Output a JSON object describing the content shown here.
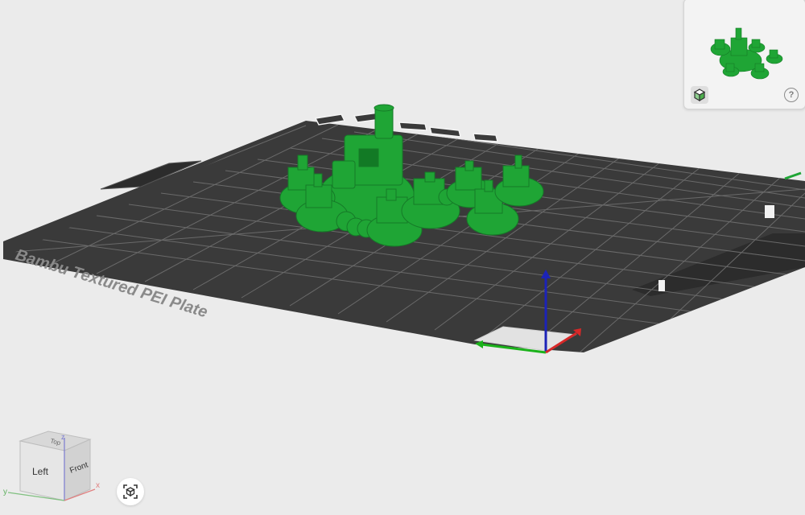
{
  "viewport": {
    "plate_label": "Bambu Textured PEI Plate",
    "plate_edge_text": "Bambu"
  },
  "viewcube": {
    "face_left": "Left",
    "face_front": "Front",
    "face_top": "Top",
    "axis_x": "x",
    "axis_y": "y",
    "axis_z": "z"
  },
  "thumbnail": {
    "help_label": "?"
  },
  "colors": {
    "background": "#ebebeb",
    "plate": "#3a3a3a",
    "model": "#1fa535",
    "axis_x": "#d62828",
    "axis_y": "#1bb21b",
    "axis_z": "#1c23b8"
  },
  "icons": {
    "fit_view": "fit-view-icon",
    "toggle_view": "cube-view-icon",
    "help": "help-icon"
  }
}
